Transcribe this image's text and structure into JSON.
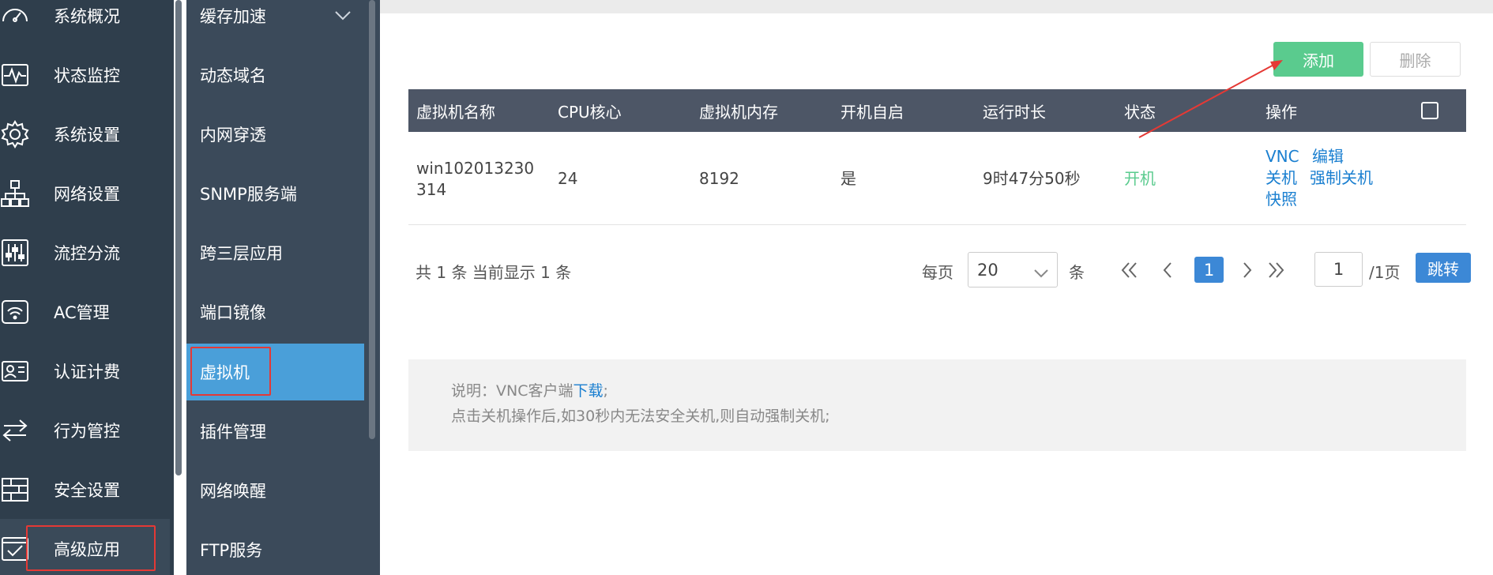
{
  "sidebar": {
    "items": [
      {
        "label": "系统概况",
        "icon": "dashboard-icon"
      },
      {
        "label": "状态监控",
        "icon": "pulse-monitor-icon"
      },
      {
        "label": "系统设置",
        "icon": "gear-icon"
      },
      {
        "label": "网络设置",
        "icon": "network-tree-icon"
      },
      {
        "label": "流控分流",
        "icon": "sliders-icon"
      },
      {
        "label": "AC管理",
        "icon": "wifi-router-icon"
      },
      {
        "label": "认证计费",
        "icon": "id-card-icon"
      },
      {
        "label": "行为管控",
        "icon": "swap-arrows-icon"
      },
      {
        "label": "安全设置",
        "icon": "firewall-icon"
      },
      {
        "label": "高级应用",
        "icon": "check-window-icon"
      }
    ],
    "active": "高级应用"
  },
  "subnav": {
    "items": [
      {
        "label": "缓存加速"
      },
      {
        "label": "动态域名"
      },
      {
        "label": "内网穿透"
      },
      {
        "label": "SNMP服务端"
      },
      {
        "label": "跨三层应用"
      },
      {
        "label": "端口镜像"
      },
      {
        "label": "虚拟机"
      },
      {
        "label": "插件管理"
      },
      {
        "label": "网络唤醒"
      },
      {
        "label": "FTP服务"
      }
    ],
    "active": "虚拟机"
  },
  "toolbar": {
    "add_label": "添加",
    "delete_label": "删除"
  },
  "table": {
    "columns": [
      "虚拟机名称",
      "CPU核心",
      "虚拟机内存",
      "开机自启",
      "运行时长",
      "状态",
      "操作"
    ],
    "rows": [
      {
        "name_line1": "win102013230",
        "name_line2": "314",
        "cpu": "24",
        "memory": "8192",
        "autostart": "是",
        "uptime": "9时47分50秒",
        "status": "开机",
        "actions": [
          "VNC",
          "编辑",
          "关机",
          "强制关机",
          "快照"
        ]
      }
    ]
  },
  "pager": {
    "total_text": "共 1 条 当前显示 1 条",
    "per_page_label": "每页",
    "per_page_value": "20",
    "per_page_unit": "条",
    "current_page": "1",
    "page_input": "1",
    "total_pages": "/1页",
    "jump_label": "跳转"
  },
  "notice": {
    "line1_prefix": "说明：VNC客户端",
    "line1_link": "下载",
    "line1_suffix": ";",
    "line2": "点击关机操作后,如30秒内无法安全关机,则自动强制关机;"
  },
  "colors": {
    "sidebar_bg": "#2f3e4c",
    "subnav_bg": "#3b4a5a",
    "subnav_active": "#4a9fd9",
    "header_bg": "#4d5666",
    "add_button": "#5acb8e",
    "link": "#1a7fd0",
    "status_on": "#5acb8e",
    "annotation_red": "#e53935"
  }
}
